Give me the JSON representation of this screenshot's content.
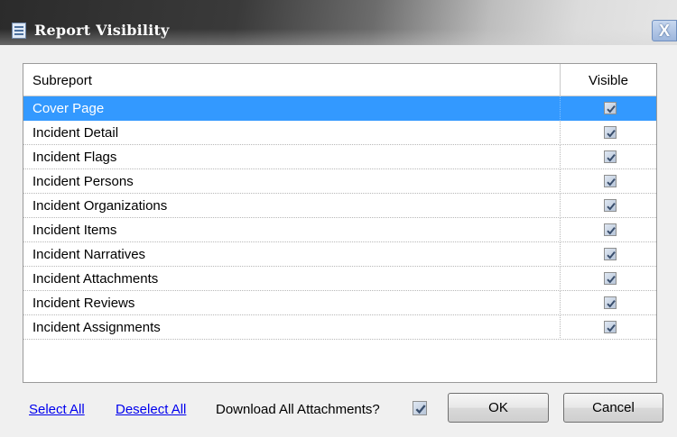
{
  "window": {
    "title": "Report Visibility",
    "close_glyph": "X"
  },
  "grid": {
    "columns": [
      "Subreport",
      "Visible"
    ],
    "rows": [
      {
        "name": "Cover Page",
        "visible": true,
        "selected": true
      },
      {
        "name": "Incident Detail",
        "visible": true,
        "selected": false
      },
      {
        "name": "Incident Flags",
        "visible": true,
        "selected": false
      },
      {
        "name": "Incident Persons",
        "visible": true,
        "selected": false
      },
      {
        "name": "Incident Organizations",
        "visible": true,
        "selected": false
      },
      {
        "name": "Incident Items",
        "visible": true,
        "selected": false
      },
      {
        "name": "Incident Narratives",
        "visible": true,
        "selected": false
      },
      {
        "name": "Incident Attachments",
        "visible": true,
        "selected": false
      },
      {
        "name": "Incident Reviews",
        "visible": true,
        "selected": false
      },
      {
        "name": "Incident Assignments",
        "visible": true,
        "selected": false
      }
    ]
  },
  "footer": {
    "select_all": "Select All",
    "deselect_all": "Deselect All",
    "download_label": "Download All Attachments?",
    "download_checked": true,
    "ok": "OK",
    "cancel": "Cancel"
  },
  "colors": {
    "selection": "#3399ff",
    "link": "#0000ee"
  },
  "icons": {
    "title": "report-icon",
    "close": "close-icon",
    "check": "checkmark-icon"
  }
}
